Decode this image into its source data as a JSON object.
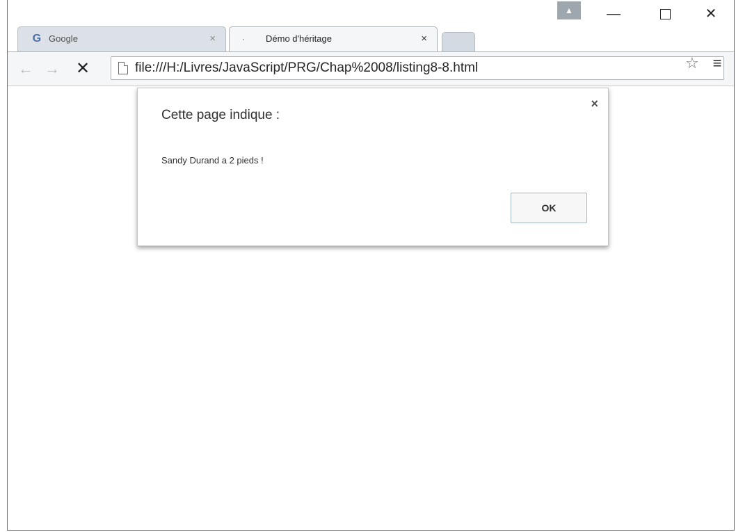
{
  "tabs": [
    {
      "favicon": "G",
      "title": "Google",
      "close": "×"
    },
    {
      "favicon": "·",
      "title": "Démo d'héritage",
      "close": "×"
    }
  ],
  "window_controls": {
    "profile": "▲",
    "minimize": "—",
    "close": "✕"
  },
  "toolbar": {
    "back": "←",
    "forward": "→",
    "stop": "✕",
    "url": "file:///H:/Livres/JavaScript/PRG/Chap%2008/listing8-8.html",
    "star": "☆",
    "menu": "≡"
  },
  "dialog": {
    "title": "Cette page indique :",
    "message": "Sandy Durand a 2 pieds !",
    "close": "×",
    "ok_label": "OK"
  }
}
